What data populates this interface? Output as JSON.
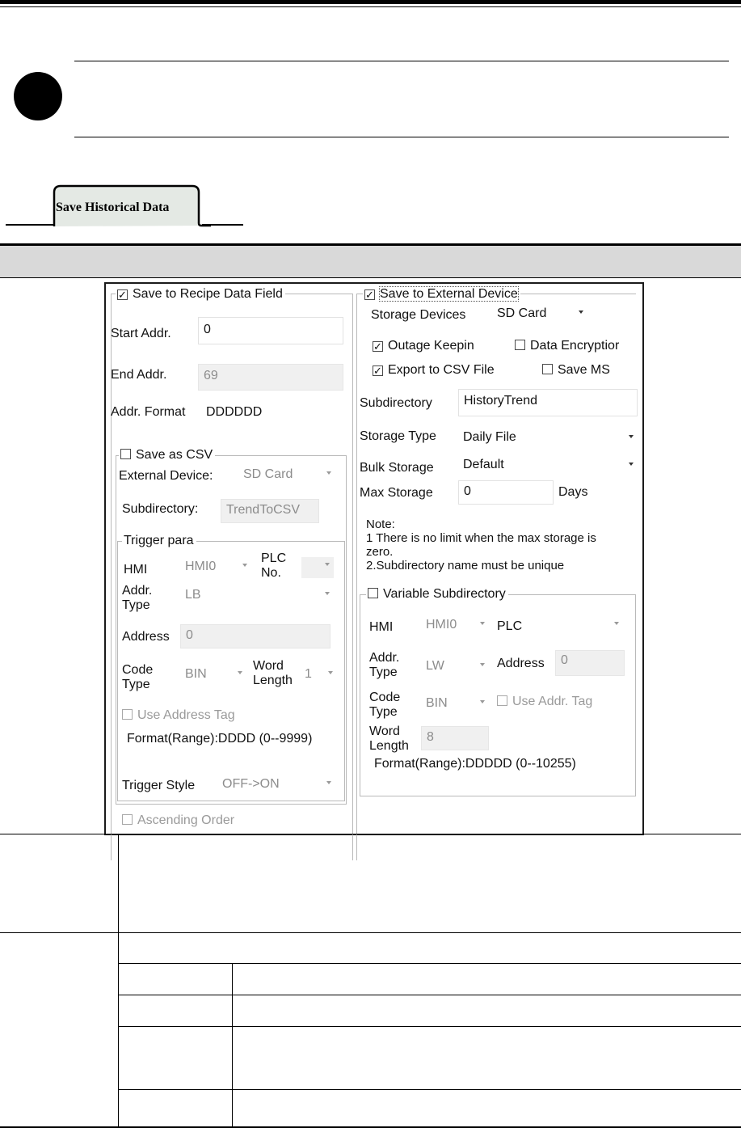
{
  "section_tab": {
    "label": "Save Historical Data"
  },
  "dialog": {
    "recipe": {
      "title": "Save to Recipe Data Field",
      "checked": true,
      "start_addr_label": "Start Addr.",
      "start_addr_value": "0",
      "end_addr_label": "End Addr.",
      "end_addr_value": "69",
      "addr_format_label": "Addr. Format",
      "addr_format_value": "DDDDDD"
    },
    "csv": {
      "title": "Save as CSV",
      "external_device_label": "External Device:",
      "external_device_value": "SD Card",
      "subdirectory_label": "Subdirectory:",
      "subdirectory_value": "TrendToCSV"
    },
    "trigger": {
      "title": "Trigger para",
      "hmi_label": "HMI",
      "hmi_value": "HMI0",
      "plc_no_label_1": "PLC",
      "plc_no_label_2": "No.",
      "addr_type_label_1": "Addr.",
      "addr_type_label_2": "Type",
      "addr_type_value": "LB",
      "address_label": "Address",
      "address_value": "0",
      "code_type_label_1": "Code",
      "code_type_label_2": "Type",
      "code_type_value": "BIN",
      "word_length_label_1": "Word",
      "word_length_label_2": "Length",
      "word_length_value": "1",
      "use_address_tag": "Use Address Tag",
      "format_range": "Format(Range):DDDD (0--9999)",
      "trigger_style_label": "Trigger Style",
      "trigger_style_value": "OFF->ON"
    },
    "ascending_order": "Ascending Order",
    "external": {
      "title": "Save to External Device",
      "checked": true,
      "storage_devices_label": "Storage Devices",
      "storage_devices_value": "SD Card",
      "outage_keepin": "Outage Keepin",
      "data_encryption": "Data Encryptior",
      "export_csv": "Export to CSV File",
      "save_ms": "Save MS",
      "subdirectory_label": "Subdirectory",
      "subdirectory_value": "HistoryTrend",
      "storage_type_label": "Storage Type",
      "storage_type_value": "Daily File",
      "bulk_storage_label": "Bulk Storage",
      "bulk_storage_value": "Default",
      "max_storage_label": "Max Storage",
      "max_storage_value": "0",
      "max_storage_unit": "Days",
      "note_1": "Note:",
      "note_2": "1 There is no limit when the max storage is",
      "note_3": "zero.",
      "note_4": "2.Subdirectory name must be unique"
    },
    "variable": {
      "title": "Variable Subdirectory",
      "hmi_label": "HMI",
      "hmi_value": "HMI0",
      "plc_label": "PLC",
      "addr_type_label_1": "Addr.",
      "addr_type_label_2": "Type",
      "addr_type_value": "LW",
      "address_label": "Address",
      "address_value": "0",
      "code_type_label_1": "Code",
      "code_type_label_2": "Type",
      "code_type_value": "BIN",
      "use_addr_tag": "Use Addr. Tag",
      "word_length_label_1": "Word",
      "word_length_label_2": "Length",
      "word_length_value": "8",
      "format_range": "Format(Range):DDDDD (0--10255)"
    }
  },
  "colors": {
    "header_band": "#d9d9d9",
    "tab_fill": "#e4e9e4"
  }
}
